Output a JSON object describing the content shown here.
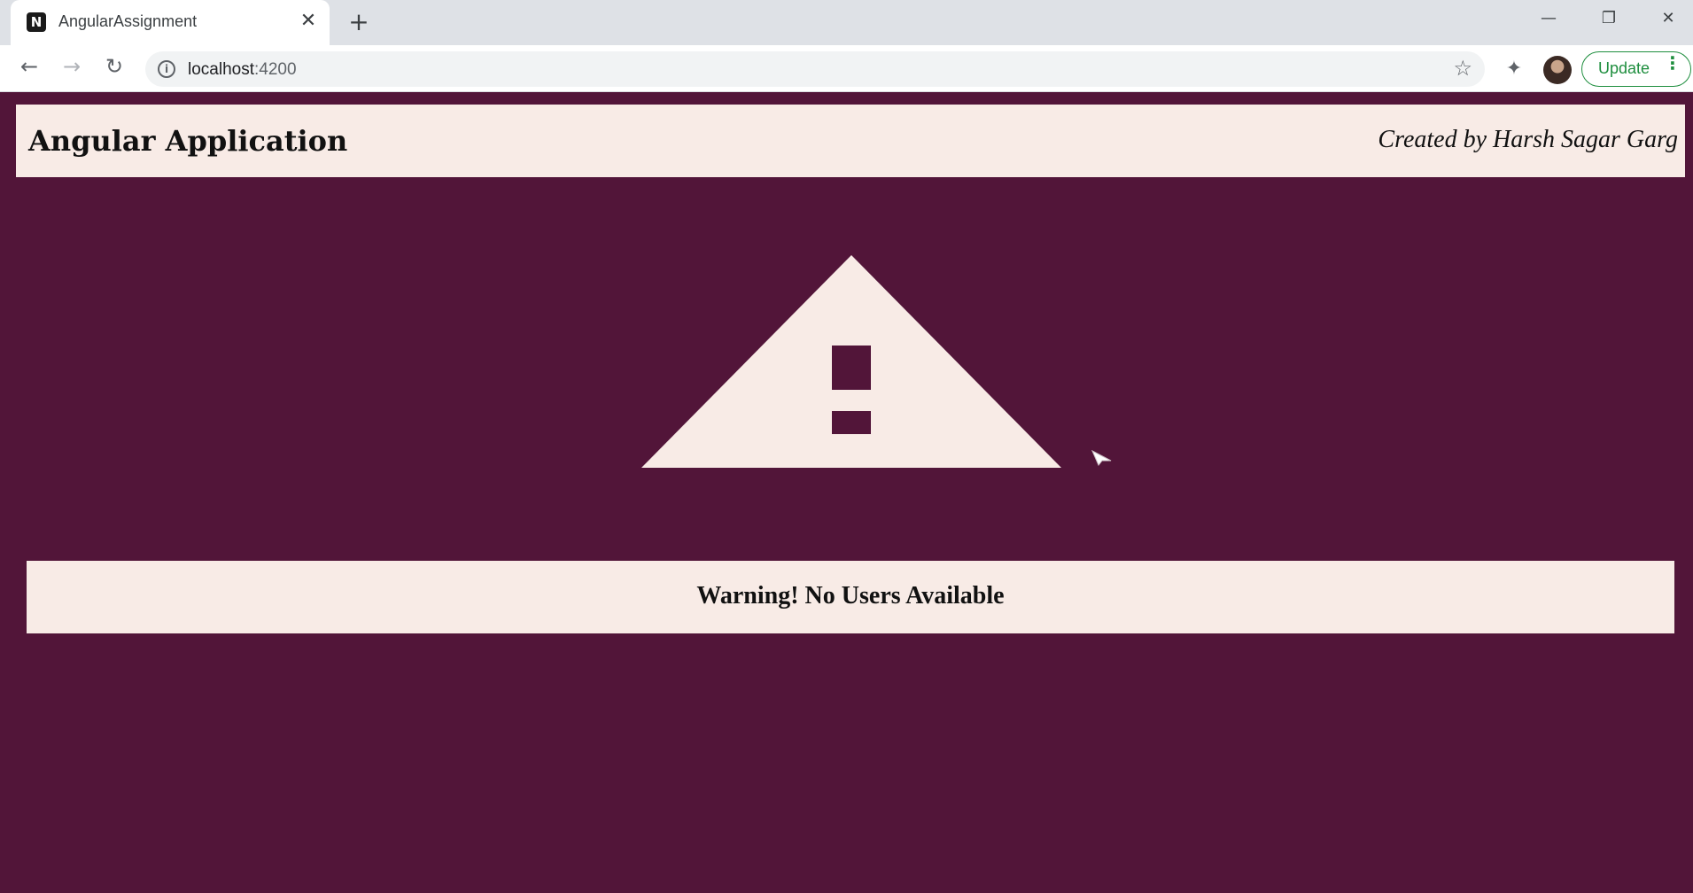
{
  "browser": {
    "tab_title": "AngularAssignment",
    "favicon_letter": "N",
    "url_host": "localhost",
    "url_port": ":4200",
    "update_label": "Update",
    "icons": {
      "back": "back-arrow-icon",
      "forward": "forward-arrow-icon",
      "reload": "reload-icon",
      "info": "site-info-icon",
      "bookmark": "star-icon",
      "extensions": "puzzle-icon",
      "menu": "vertical-dots-icon"
    }
  },
  "header": {
    "title": "Angular Application",
    "credit": "Created by Harsh Sagar Garg"
  },
  "main": {
    "warning_icon": "warning-triangle-icon",
    "warning_message": "Warning! No Users Available"
  },
  "colors": {
    "page_background": "#521539",
    "panel_background": "#f8ebe6",
    "text": "#111111",
    "update_accent": "#1e8e3e"
  }
}
